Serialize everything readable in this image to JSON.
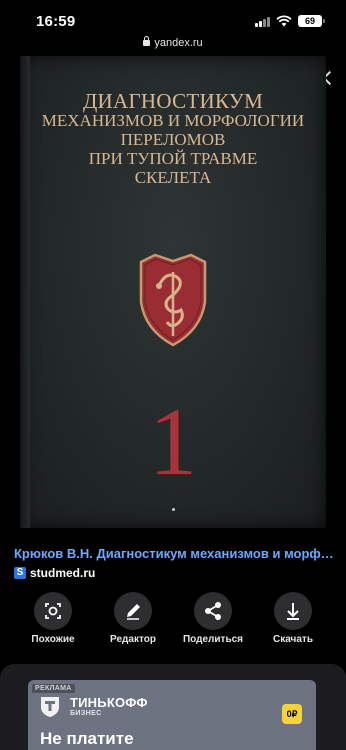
{
  "status_bar": {
    "time": "16:59",
    "battery": "69"
  },
  "browser": {
    "url": "yandex.ru"
  },
  "image": {
    "title_lines": [
      "ДИАГНОСТИКУМ",
      "МЕХАНИЗМОВ И МОРФОЛОГИИ",
      "ПЕРЕЛОМОВ",
      "ПРИ ТУПОЙ ТРАВМЕ",
      "СКЕЛЕТА"
    ],
    "volume": "1"
  },
  "result": {
    "title": "Крюков В.Н. Диагностикум механизмов и морфологии",
    "source_letter": "S",
    "source": "studmed.ru"
  },
  "actions": [
    {
      "label": "Похожие",
      "icon": "lens-icon"
    },
    {
      "label": "Редактор",
      "icon": "pencil-icon"
    },
    {
      "label": "Поделиться",
      "icon": "share-icon"
    },
    {
      "label": "Скачать",
      "icon": "download-icon"
    }
  ],
  "ad": {
    "badge": "РЕКЛАМА",
    "brand": "ТИНЬКОФФ",
    "brand_sub": "БИЗНЕС",
    "headline": "Не платите",
    "chip": "0₽"
  },
  "colors": {
    "link": "#6fa8ff",
    "title_gold": "#d8b792",
    "volume_red": "#a8343b",
    "ad_chip": "#f7d33b"
  }
}
